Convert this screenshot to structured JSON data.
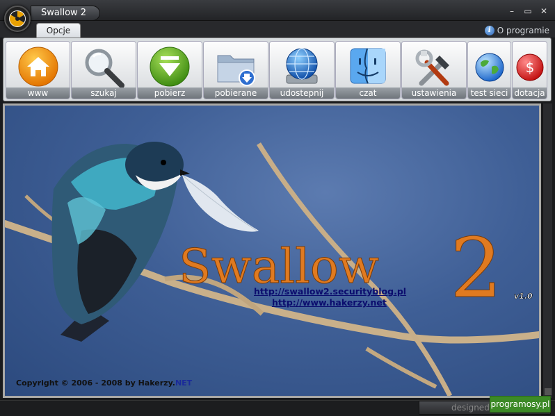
{
  "window": {
    "title": "Swallow 2",
    "minimize": "–",
    "maximize": "▭",
    "close": "✕"
  },
  "tabs": [
    {
      "label": "Opcje",
      "active": true
    }
  ],
  "about": {
    "label": "O programie",
    "icon": "info-icon"
  },
  "toolbar": {
    "items": [
      {
        "label": "www",
        "icon": "home-icon"
      },
      {
        "label": "szukaj",
        "icon": "magnifier-icon"
      },
      {
        "label": "pobierz",
        "icon": "download-arrow-icon"
      },
      {
        "label": "pobierane",
        "icon": "downloads-folder-icon"
      },
      {
        "label": "udostepnij",
        "icon": "network-share-icon"
      },
      {
        "label": "czat",
        "icon": "finder-face-icon"
      },
      {
        "label": "ustawienia",
        "icon": "tools-icon"
      },
      {
        "label": "test sieci",
        "icon": "globe-icon"
      },
      {
        "label": "dotacja",
        "icon": "dollar-icon"
      }
    ]
  },
  "content": {
    "logo_text": "Swallow",
    "logo_number": "2",
    "version": "v1.0",
    "link1": "http://swallow2.securityblog.pl",
    "link2": "http://www.hakerzy.net",
    "copyright_prefix": "Copyright © 2006 - 2008 by Hakerzy.",
    "copyright_suffix": "NET"
  },
  "status": {
    "designed": "designed by",
    "badge": "programosy.pl"
  },
  "colors": {
    "accent_orange": "#e07a20",
    "link_blue": "#0b0d6e",
    "badge_green": "#3c8a26"
  }
}
